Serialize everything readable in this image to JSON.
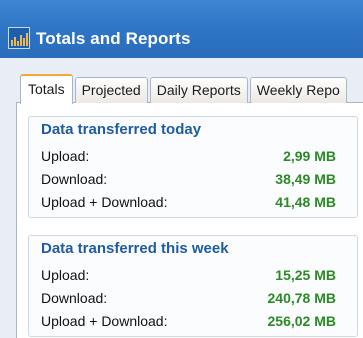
{
  "window": {
    "title": "Totals and Reports"
  },
  "tabs": [
    {
      "label": "Totals"
    },
    {
      "label": "Projected"
    },
    {
      "label": "Daily Reports"
    },
    {
      "label": "Weekly Repo"
    }
  ],
  "today": {
    "title": "Data transferred today",
    "rows": [
      {
        "label": "Upload:",
        "value": "2,99 MB"
      },
      {
        "label": "Download:",
        "value": "38,49 MB"
      },
      {
        "label": "Upload + Download:",
        "value": "41,48 MB"
      }
    ]
  },
  "week": {
    "title": "Data transferred this week",
    "rows": [
      {
        "label": "Upload:",
        "value": "15,25 MB"
      },
      {
        "label": "Download:",
        "value": "240,78 MB"
      },
      {
        "label": "Upload + Download:",
        "value": "256,02 MB"
      }
    ]
  },
  "colors": {
    "titlebar": "#2f76c6",
    "group_title": "#1f5da0",
    "value": "#2c8a26",
    "active_tab_accent": "#f2a935"
  },
  "icons": {
    "app": "bar-graph-icon"
  }
}
